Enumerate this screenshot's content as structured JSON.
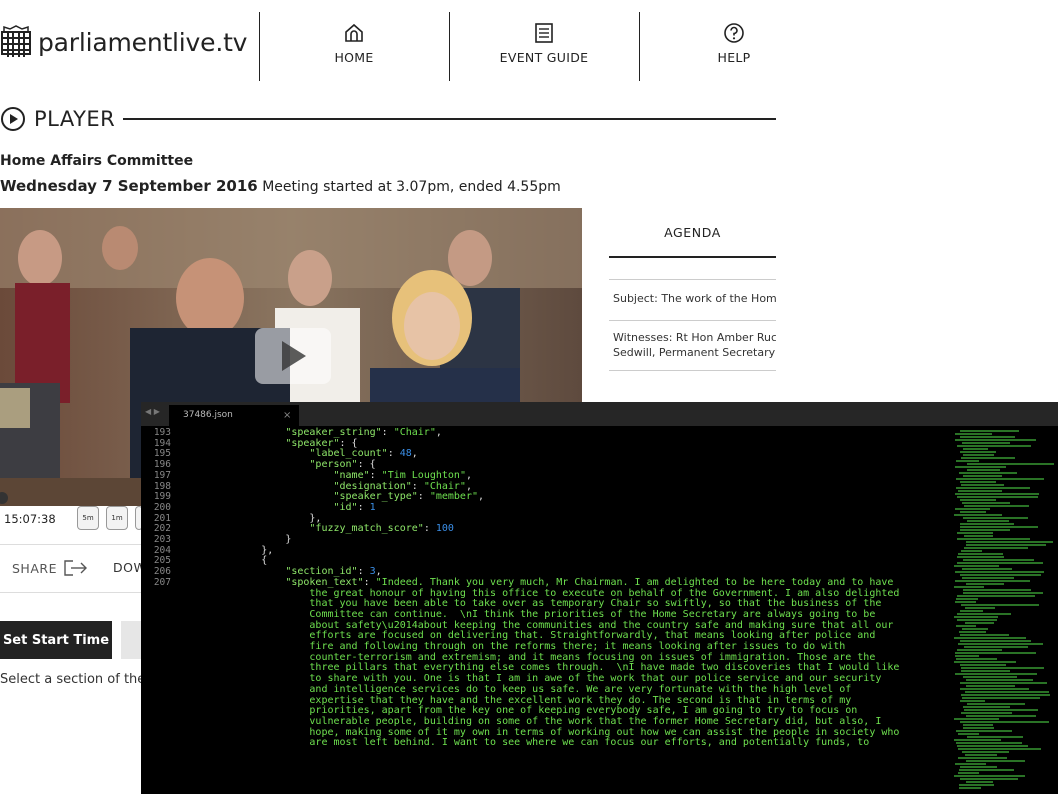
{
  "header": {
    "site_name": "parliamentlive.tv",
    "nav": [
      {
        "label": "HOME",
        "icon": "home-icon"
      },
      {
        "label": "EVENT GUIDE",
        "icon": "document-icon"
      },
      {
        "label": "HELP",
        "icon": "help-icon"
      }
    ]
  },
  "player": {
    "heading": "PLAYER",
    "committee": "Home Affairs Committee",
    "date": "Wednesday 7 September 2016",
    "meeting_info": "Meeting started at 3.07pm, ended 4.55pm",
    "current_time": "15:07:38",
    "rewind_5m": "5m",
    "rewind_1m": "1m",
    "share_label": "SHARE",
    "download_label": "DOW",
    "set_start_label": "Set Start Time",
    "select_note": "Select a section of the"
  },
  "agenda": {
    "tab_label": "AGENDA",
    "subject": "Subject: The work of the Hom",
    "witnesses_line1": "Witnesses: Rt Hon Amber Ruc",
    "witnesses_line2": "Sedwill, Permanent Secretary"
  },
  "editor": {
    "tab_title": "37486.json",
    "line_numbers": [
      "193",
      "194",
      "195",
      "196",
      "197",
      "198",
      "199",
      "200",
      "201",
      "202",
      "203",
      "204",
      "205",
      "206",
      "207"
    ],
    "code_lines": [
      [
        {
          "t": "                \"speaker_string\"",
          "c": "k"
        },
        {
          "t": ": ",
          "c": "p"
        },
        {
          "t": "\"Chair\"",
          "c": "s"
        },
        {
          "t": ",",
          "c": "p"
        }
      ],
      [
        {
          "t": "                \"speaker\"",
          "c": "k"
        },
        {
          "t": ": {",
          "c": "p"
        }
      ],
      [
        {
          "t": "                    \"label_count\"",
          "c": "k"
        },
        {
          "t": ": ",
          "c": "p"
        },
        {
          "t": "48",
          "c": "n"
        },
        {
          "t": ",",
          "c": "p"
        }
      ],
      [
        {
          "t": "                    \"person\"",
          "c": "k"
        },
        {
          "t": ": {",
          "c": "p"
        }
      ],
      [
        {
          "t": "                        \"name\"",
          "c": "k"
        },
        {
          "t": ": ",
          "c": "p"
        },
        {
          "t": "\"Tim Loughton\"",
          "c": "s"
        },
        {
          "t": ",",
          "c": "p"
        }
      ],
      [
        {
          "t": "                        \"designation\"",
          "c": "k"
        },
        {
          "t": ": ",
          "c": "p"
        },
        {
          "t": "\"Chair\"",
          "c": "s"
        },
        {
          "t": ",",
          "c": "p"
        }
      ],
      [
        {
          "t": "                        \"speaker_type\"",
          "c": "k"
        },
        {
          "t": ": ",
          "c": "p"
        },
        {
          "t": "\"member\"",
          "c": "s"
        },
        {
          "t": ",",
          "c": "p"
        }
      ],
      [
        {
          "t": "                        \"id\"",
          "c": "k"
        },
        {
          "t": ": ",
          "c": "p"
        },
        {
          "t": "1",
          "c": "n"
        }
      ],
      [
        {
          "t": "                    },",
          "c": "p"
        }
      ],
      [
        {
          "t": "                    \"fuzzy_match_score\"",
          "c": "k"
        },
        {
          "t": ": ",
          "c": "p"
        },
        {
          "t": "100",
          "c": "n"
        }
      ],
      [
        {
          "t": "                }",
          "c": "p"
        }
      ],
      [
        {
          "t": "            },",
          "c": "p"
        }
      ],
      [
        {
          "t": "            {",
          "c": "p"
        }
      ],
      [
        {
          "t": "                \"section_id\"",
          "c": "k"
        },
        {
          "t": ": ",
          "c": "p"
        },
        {
          "t": "3",
          "c": "n"
        },
        {
          "t": ",",
          "c": "p"
        }
      ],
      [
        {
          "t": "                \"spoken_text\"",
          "c": "k"
        },
        {
          "t": ": ",
          "c": "p"
        },
        {
          "t": "\"Indeed. Thank you very much, Mr Chairman. I am delighted to be here today and to have",
          "c": "s"
        }
      ],
      [
        {
          "t": "                    the great honour of having this office to execute on behalf of the Government. I am also delighted",
          "c": "s"
        }
      ],
      [
        {
          "t": "                    that you have been able to take over as temporary Chair so swiftly, so that the business of the",
          "c": "s"
        }
      ],
      [
        {
          "t": "                    Committee can continue.  \\nI think the priorities of the Home Secretary are always going to be",
          "c": "s"
        }
      ],
      [
        {
          "t": "                    about safety\\u2014about keeping the communities and the country safe and making sure that all our",
          "c": "s"
        }
      ],
      [
        {
          "t": "                    efforts are focused on delivering that. Straightforwardly, that means looking after police and",
          "c": "s"
        }
      ],
      [
        {
          "t": "                    fire and following through on the reforms there; it means looking after issues to do with",
          "c": "s"
        }
      ],
      [
        {
          "t": "                    counter-terrorism and extremism; and it means focusing on issues of immigration. Those are the",
          "c": "s"
        }
      ],
      [
        {
          "t": "                    three pillars that everything else comes through.  \\nI have made two discoveries that I would like",
          "c": "s"
        }
      ],
      [
        {
          "t": "                    to share with you. One is that I am in awe of the work that our police service and our security",
          "c": "s"
        }
      ],
      [
        {
          "t": "                    and intelligence services do to keep us safe. We are very fortunate with the high level of",
          "c": "s"
        }
      ],
      [
        {
          "t": "                    expertise that they have and the excellent work they do. The second is that in terms of my",
          "c": "s"
        }
      ],
      [
        {
          "t": "                    priorities, apart from the key one of keeping everybody safe, I am going to try to focus on",
          "c": "s"
        }
      ],
      [
        {
          "t": "                    vulnerable people, building on some of the work that the former Home Secretary did, but also, I",
          "c": "s"
        }
      ],
      [
        {
          "t": "                    hope, making some of it my own in terms of working out how we can assist the people in society who",
          "c": "s"
        }
      ],
      [
        {
          "t": "                    are most left behind. I want to see where we can focus our efforts, and potentially funds, to",
          "c": "s"
        }
      ]
    ]
  },
  "colors": {
    "editor_bg": "#000000",
    "json_key": "#8fe86a",
    "json_string": "#6ee04f",
    "json_number": "#3b8fe8"
  }
}
